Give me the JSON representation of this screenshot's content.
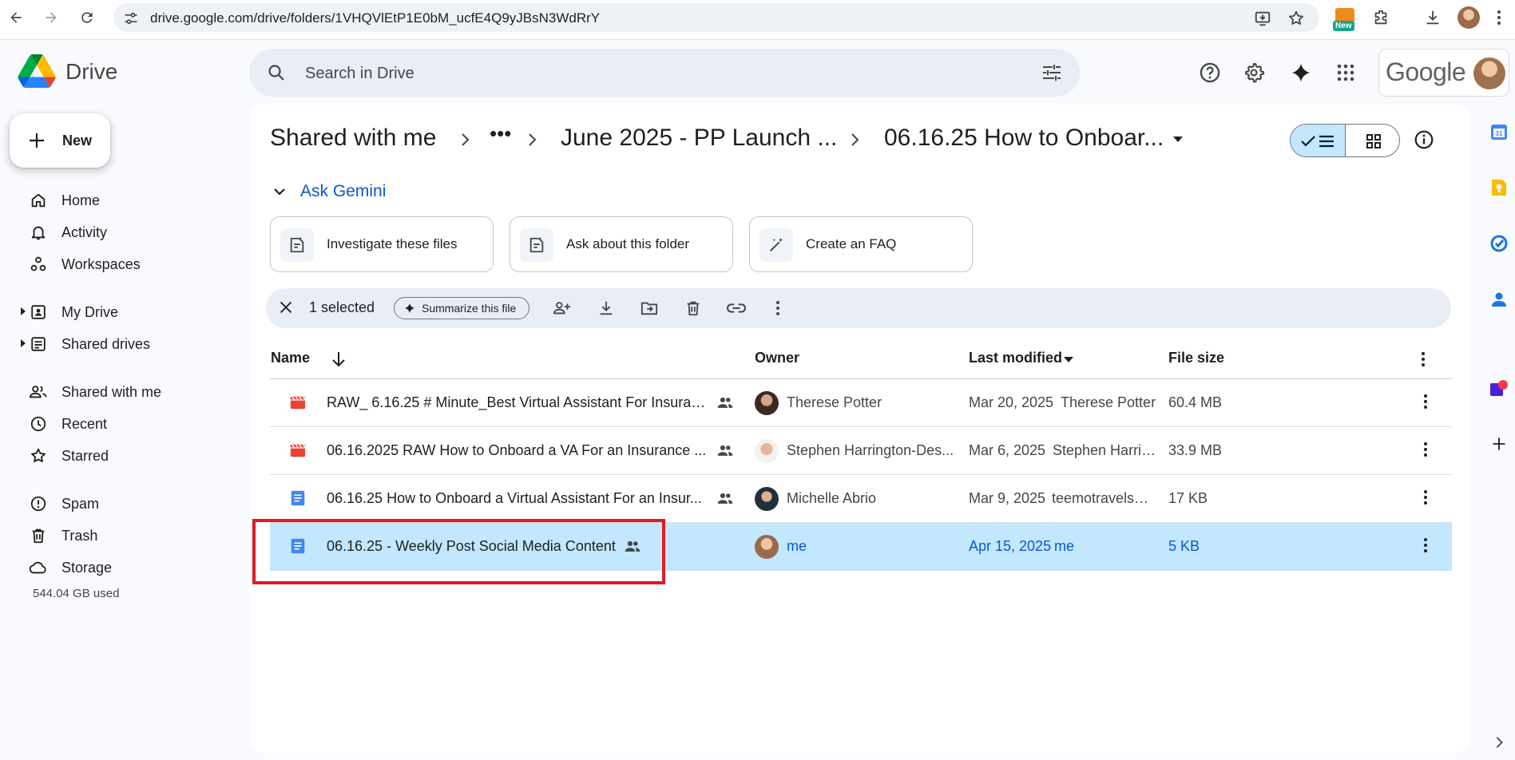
{
  "browser": {
    "url": "drive.google.com/drive/folders/1VHQVlEtP1E0bM_ucfE4Q9yJBsN3WdRrY",
    "ext_badge": "New"
  },
  "app": {
    "name": "Drive",
    "google_word": "Google"
  },
  "search": {
    "placeholder": "Search in Drive"
  },
  "nav": {
    "new_label": "New",
    "items": [
      {
        "label": "Home",
        "icon": "home-icon"
      },
      {
        "label": "Activity",
        "icon": "bell-icon"
      },
      {
        "label": "Workspaces",
        "icon": "workspaces-icon"
      },
      {
        "label": "My Drive",
        "icon": "my-drive-icon"
      },
      {
        "label": "Shared drives",
        "icon": "shared-drives-icon"
      },
      {
        "label": "Shared with me",
        "icon": "people-icon"
      },
      {
        "label": "Recent",
        "icon": "clock-icon"
      },
      {
        "label": "Starred",
        "icon": "star-icon"
      },
      {
        "label": "Spam",
        "icon": "spam-icon"
      },
      {
        "label": "Trash",
        "icon": "trash-icon"
      },
      {
        "label": "Storage",
        "icon": "cloud-icon"
      }
    ],
    "storage_used": "544.04 GB used"
  },
  "breadcrumb": {
    "root": "Shared with me",
    "ellipsis": "•••",
    "parent": "June 2025 - PP Launch ...",
    "current": "06.16.25 How to Onboar..."
  },
  "gemini": {
    "label": "Ask Gemini",
    "chips": [
      {
        "label": "Investigate these files"
      },
      {
        "label": "Ask about this folder"
      },
      {
        "label": "Create an FAQ"
      }
    ]
  },
  "selection": {
    "count": "1 selected",
    "summarize": "Summarize this file"
  },
  "table": {
    "columns": {
      "name": "Name",
      "owner": "Owner",
      "modified": "Last modified",
      "size": "File size"
    },
    "rows": [
      {
        "type": "video",
        "name": "RAW_ 6.16.25 # Minute_Best Virtual Assistant For Insuran...",
        "owner": "Therese Potter",
        "date": "Mar 20, 2025",
        "by": "Therese Potter",
        "size": "60.4 MB",
        "selected": false
      },
      {
        "type": "video",
        "name": "06.16.2025 RAW How to Onboard a VA For an Insurance ...",
        "owner": "Stephen Harrington-Des...",
        "date": "Mar 6, 2025",
        "by": "Stephen Harrin...",
        "size": "33.9 MB",
        "selected": false
      },
      {
        "type": "doc",
        "name": "06.16.25 How to Onboard a Virtual Assistant For an Insur...",
        "owner": "Michelle Abrio",
        "date": "Mar 9, 2025",
        "by": "teemotravels@...",
        "size": "17 KB",
        "selected": false
      },
      {
        "type": "doc",
        "name": "06.16.25 - Weekly Post Social Media Content",
        "owner": "me",
        "date": "Apr 15, 2025",
        "by": "me",
        "size": "5 KB",
        "selected": true
      }
    ]
  },
  "colors": {
    "accent": "#0b57d0",
    "selected_row": "#c2e7ff",
    "highlight_box": "#e01b24",
    "video_icon": "#ea4335",
    "doc_icon": "#4285f4"
  }
}
